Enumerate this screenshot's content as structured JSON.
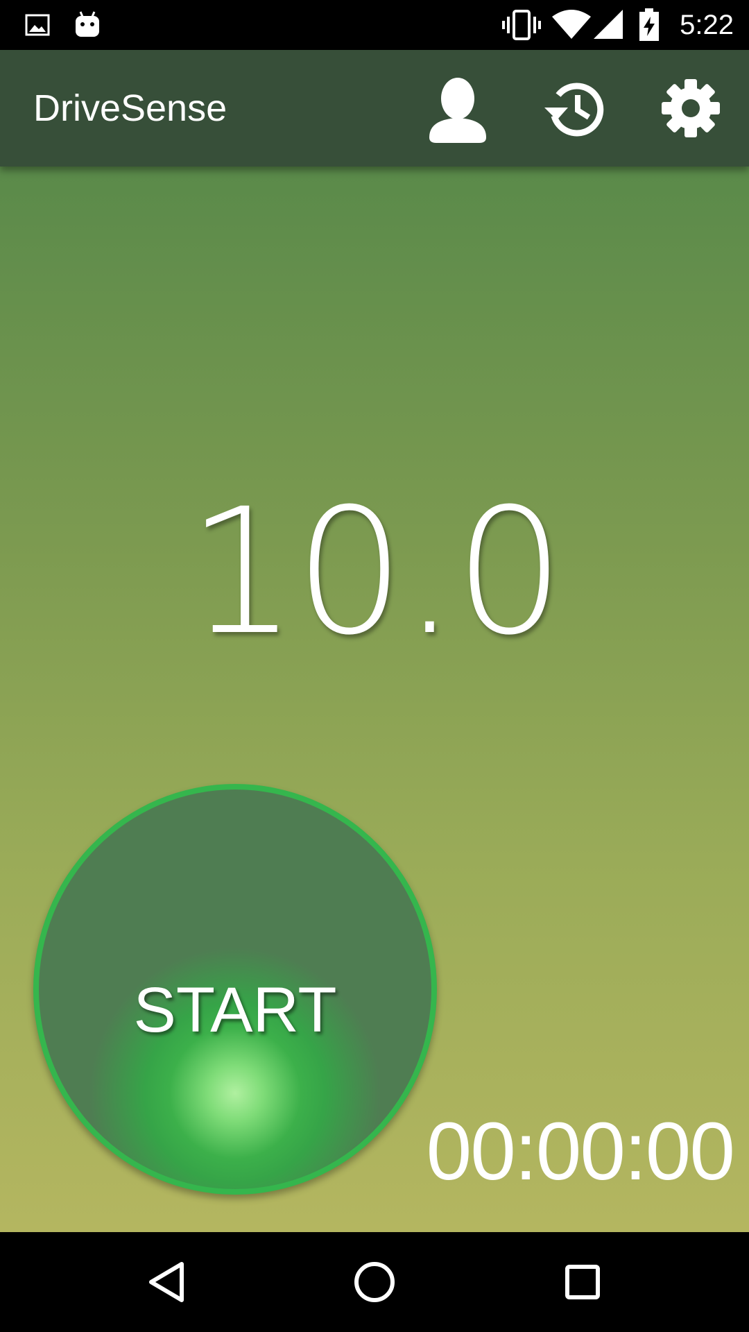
{
  "status_bar": {
    "time": "5:22",
    "icons": [
      "image-notification-icon",
      "android-notification-icon",
      "vibrate-icon",
      "wifi-icon",
      "cell-signal-icon",
      "battery-charging-icon"
    ]
  },
  "app_bar": {
    "title": "DriveSense",
    "actions": [
      "profile-icon",
      "history-icon",
      "settings-icon"
    ]
  },
  "main": {
    "speed": "10.0",
    "start_label": "START",
    "timer": "00:00:00"
  },
  "nav_bar": {
    "buttons": [
      "back-icon",
      "home-icon",
      "recents-icon"
    ]
  },
  "colors": {
    "app_bar": "#374f39",
    "start_ring": "#35b64d",
    "start_fill": "#4f7d52",
    "gradient_top": "#5a8a4a",
    "gradient_bottom": "#b4b660"
  }
}
